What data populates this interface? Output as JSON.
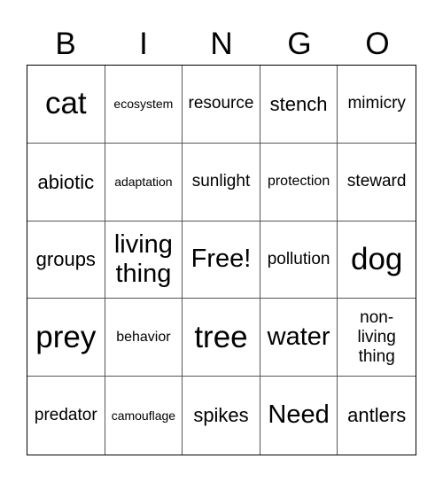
{
  "header": [
    "B",
    "I",
    "N",
    "G",
    "O"
  ],
  "cells": [
    {
      "text": "cat",
      "size": "xl"
    },
    {
      "text": "ecosystem",
      "size": "xs"
    },
    {
      "text": "resource",
      "size": "s"
    },
    {
      "text": "stench",
      "size": "m"
    },
    {
      "text": "mimicry",
      "size": "s"
    },
    {
      "text": "abiotic",
      "size": "m"
    },
    {
      "text": "adaptation",
      "size": "xs"
    },
    {
      "text": "sunlight",
      "size": "s"
    },
    {
      "text": "protection",
      "size": "xs2"
    },
    {
      "text": "steward",
      "size": "s"
    },
    {
      "text": "groups",
      "size": "m"
    },
    {
      "text": "living thing",
      "size": "l"
    },
    {
      "text": "Free!",
      "size": "l"
    },
    {
      "text": "pollution",
      "size": "s"
    },
    {
      "text": "dog",
      "size": "xl"
    },
    {
      "text": "prey",
      "size": "xl"
    },
    {
      "text": "behavior",
      "size": "xs2"
    },
    {
      "text": "tree",
      "size": "xl"
    },
    {
      "text": "water",
      "size": "l"
    },
    {
      "text": "non-living thing",
      "size": "s"
    },
    {
      "text": "predator",
      "size": "s"
    },
    {
      "text": "camouflage",
      "size": "xs"
    },
    {
      "text": "spikes",
      "size": "m"
    },
    {
      "text": "Need",
      "size": "l"
    },
    {
      "text": "antlers",
      "size": "m"
    }
  ]
}
